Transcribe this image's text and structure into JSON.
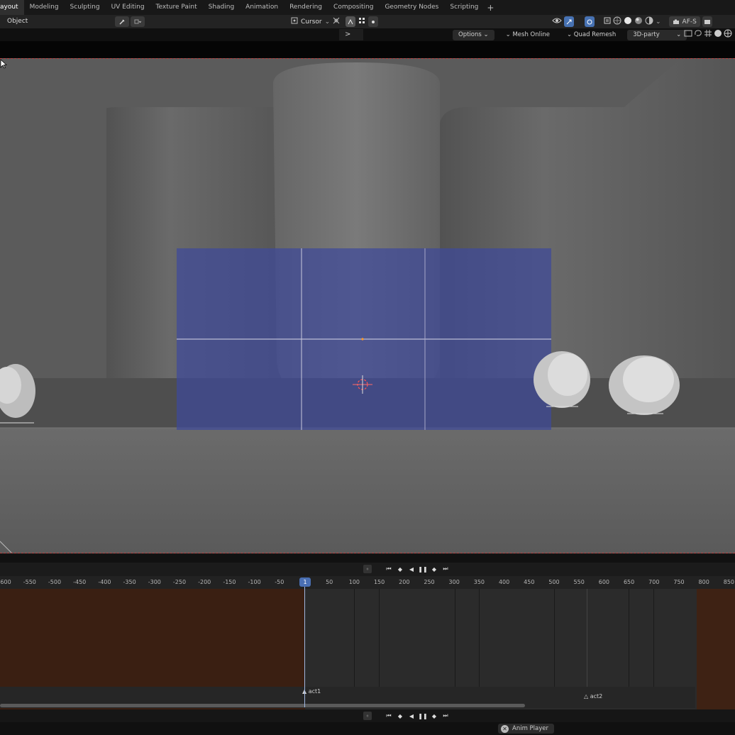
{
  "workspace_tabs": [
    {
      "label": "ayout",
      "active": true
    },
    {
      "label": "Modeling"
    },
    {
      "label": "Sculpting"
    },
    {
      "label": "UV Editing"
    },
    {
      "label": "Texture Paint"
    },
    {
      "label": "Shading"
    },
    {
      "label": "Animation"
    },
    {
      "label": "Rendering"
    },
    {
      "label": "Compositing"
    },
    {
      "label": "Geometry Nodes"
    },
    {
      "label": "Scripting"
    }
  ],
  "add_workspace": "+",
  "header": {
    "mode": "Object",
    "cursor_label": "Cursor",
    "render_engine": "AF-S"
  },
  "tool_header": {
    "chevron": ">",
    "options_label": "Options",
    "mesh_online_label": "Mesh Online",
    "quad_remesh_label": "Quad Remesh",
    "third_party_label": "3D-party"
  },
  "timeline": {
    "ruler_ticks": [
      "-600",
      "-550",
      "-500",
      "-450",
      "-400",
      "-350",
      "-300",
      "-250",
      "-200",
      "-150",
      "-100",
      "-50",
      "50",
      "100",
      "150",
      "200",
      "250",
      "300",
      "350",
      "400",
      "450",
      "500",
      "550",
      "600",
      "650",
      "700",
      "750",
      "800",
      "850"
    ],
    "current_frame": "1",
    "markers": [
      {
        "label": "act1"
      },
      {
        "label": "act2"
      }
    ]
  },
  "status": {
    "addon_label": "Anim Player"
  },
  "colors": {
    "camera_frame": "#3f4a9a",
    "action_strip": "#3a1f12",
    "accent": "#4772b3"
  }
}
